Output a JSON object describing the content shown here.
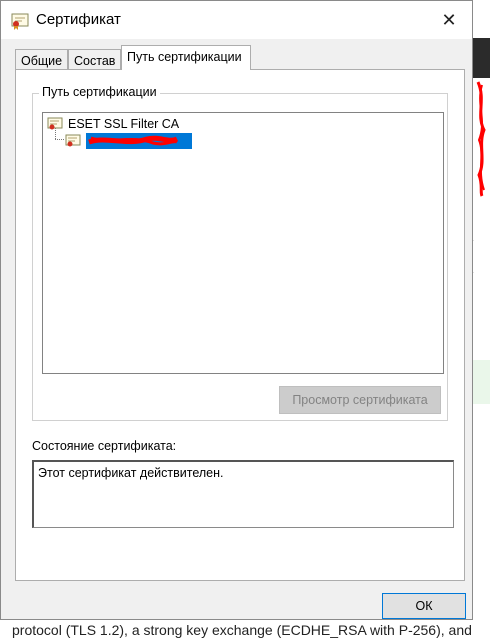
{
  "window": {
    "title": "Сертификат",
    "close_symbol": "✕"
  },
  "tabs": [
    {
      "label": "Общие",
      "active": false
    },
    {
      "label": "Состав",
      "active": false
    },
    {
      "label": "Путь сертификации",
      "active": true
    }
  ],
  "cert_path": {
    "group_label": "Путь сертификации",
    "tree": [
      {
        "label": "ESET SSL Filter CA",
        "icon": "certificate-icon",
        "level": 0
      },
      {
        "label": "",
        "icon": "certificate-icon",
        "level": 1,
        "selected": true,
        "redacted": true
      }
    ],
    "view_button_label": "Просмотр сертификата",
    "view_button_enabled": false
  },
  "status": {
    "label": "Состояние сертификата:",
    "text": "Этот сертификат действителен."
  },
  "footer": {
    "ok_label": "ОК"
  },
  "background": {
    "bottom_text": "protocol (TLS 1.2), a strong key exchange (ECDHE_RSA with P-256), and"
  },
  "colors": {
    "selection": "#0078d7",
    "redaction": "#ff0000"
  }
}
